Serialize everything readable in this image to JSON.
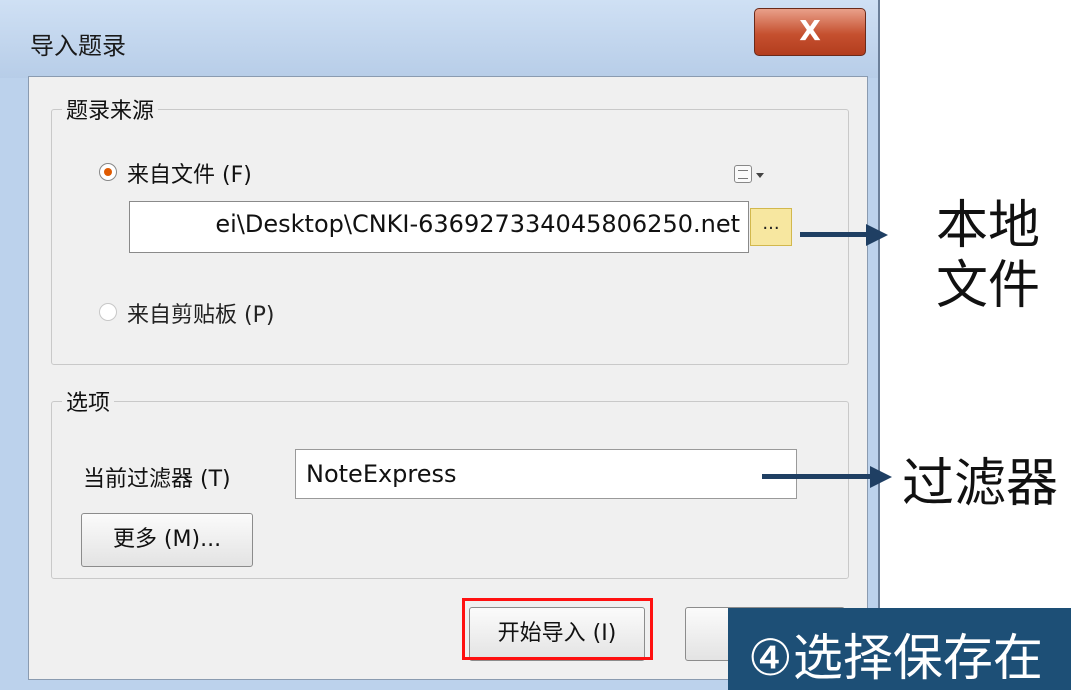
{
  "dialog": {
    "title": "导入题录",
    "close_label": "X"
  },
  "source_group": {
    "legend": "题录来源",
    "from_file_label": "来自文件 (F)",
    "file_path_value": "ei\\Desktop\\CNKI-636927334045806250.net",
    "browse_label": "...",
    "from_clipboard_label": "来自剪贴板 (P)",
    "selected": "from_file"
  },
  "options_group": {
    "legend": "选项",
    "filter_label": "当前过滤器 (T)",
    "filter_value": "NoteExpress",
    "more_label": "更多 (M)..."
  },
  "footer": {
    "start_label": "开始导入 (I)"
  },
  "annotations": {
    "local_file": "本地\n文件",
    "filter": "过滤器",
    "banner": "④选择保存在"
  },
  "colors": {
    "highlight": "#ff1010",
    "arrow": "#1f3f63",
    "banner_bg": "#1d4f76"
  }
}
